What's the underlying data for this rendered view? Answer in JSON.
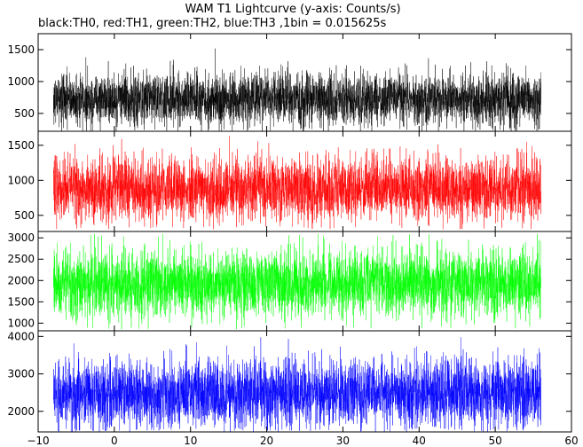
{
  "chart_data": {
    "type": "line",
    "title": "WAM T1 Lightcurve (y-axis: Counts/s)",
    "subtitle": "black:TH0, red:TH1, green:TH2, blue:TH3 ,1bin = 0.015625s",
    "bin_seconds": 0.015625,
    "x_range": [
      -8,
      56
    ],
    "xlim": [
      -10,
      60
    ],
    "x_ticks": [
      -10,
      0,
      10,
      20,
      30,
      40,
      50,
      60
    ],
    "grid": false,
    "legend": "none",
    "panels": [
      {
        "name": "TH0",
        "color": "#000000",
        "ylim": [
          220,
          1750
        ],
        "y_ticks": [
          500,
          1000,
          1500
        ],
        "mean": 720,
        "std": 205,
        "y_min": 150,
        "y_max": 1700
      },
      {
        "name": "TH1",
        "color": "#ff0000",
        "ylim": [
          270,
          1700
        ],
        "y_ticks": [
          500,
          1000,
          1500
        ],
        "mean": 880,
        "std": 225,
        "y_min": 300,
        "y_max": 1650
      },
      {
        "name": "TH2",
        "color": "#00ff00",
        "ylim": [
          820,
          3150
        ],
        "y_ticks": [
          1000,
          1500,
          2000,
          2500,
          3000
        ],
        "mean": 1920,
        "std": 390,
        "y_min": 850,
        "y_max": 3100
      },
      {
        "name": "TH3",
        "color": "#0000ff",
        "ylim": [
          1450,
          4150
        ],
        "y_ticks": [
          2000,
          3000,
          4000
        ],
        "mean": 2470,
        "std": 440,
        "y_min": 1450,
        "y_max": 4050
      }
    ]
  }
}
